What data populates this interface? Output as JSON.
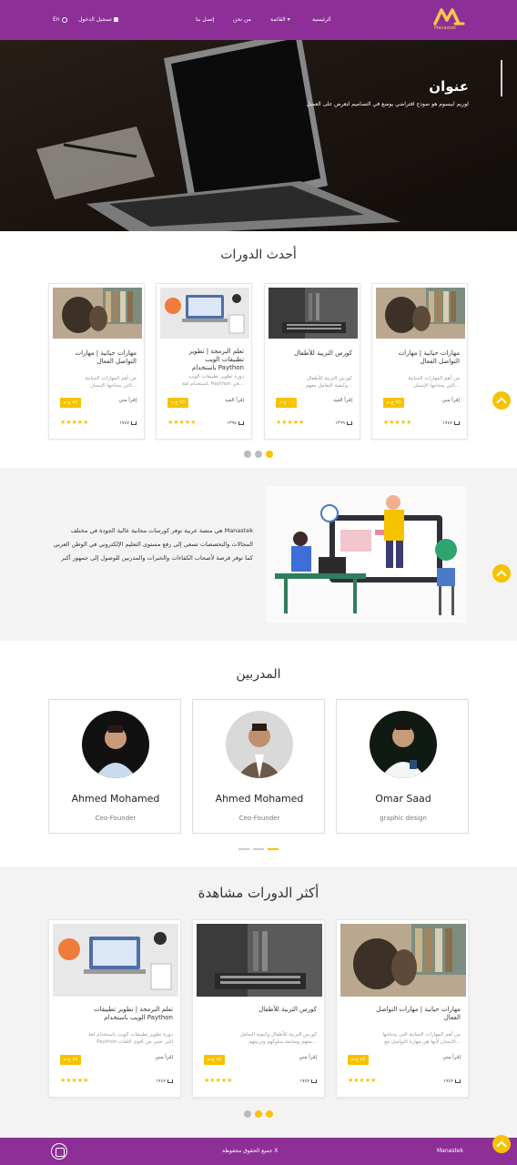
{
  "header": {
    "logo_text": "Manastek",
    "nav": {
      "home": "الرئيسية",
      "menu": "القائمة ▾",
      "about": "من نحن",
      "contact": "إتصل بنا",
      "login": "تسجيل الدخول",
      "lang": "En"
    }
  },
  "hero": {
    "title": "عنوان",
    "subtitle": "لوريم ايبسوم هو نموذج افتراضي يوضع في التصاميم لتعرض على العميل"
  },
  "latest": {
    "title": "أحدث الدورات",
    "cards": [
      {
        "title_1": "مهارات حياتية | مهارات",
        "title_2": "التواصل الفعال",
        "desc_1": "من أهم المهارات الحياتية",
        "desc_2": "التي يحتاجها الإنسان...",
        "teacher": "إقرأ مني",
        "price": "٤٥ ج.م",
        "views": "١٧٤٧",
        "stars": "★★★★★"
      },
      {
        "title_1": "كورس التربية للأطفال",
        "title_2": "",
        "desc_1": "كورس التربية للأطفال",
        "desc_2": "وكيفية التعامل معهم...",
        "teacher": "إقرأ العيد",
        "price": "٠٠ ج.م",
        "views": "١٣٦٩",
        "stars": "★★★★★"
      },
      {
        "title_1": "تعلم البرمجة | تطوير",
        "title_2": "تطبيقات الويب",
        "title_3": "باستخدام Paython",
        "desc_1": "دورة تطوير تطبيقات الويب",
        "desc_2": "باستخدام لغة Paython في...",
        "teacher": "إقرأ العيد",
        "price": "٤٥ ج.م",
        "views": "١٣٩٤",
        "stars": "★★★★★"
      },
      {
        "title_1": "مهارات حياتية | مهارات",
        "title_2": "التواصل الفعال",
        "desc_1": "من أهم المهارات الحياتية",
        "desc_2": "التي يحتاجها الإنسان...",
        "teacher": "إقرأ مني",
        "price": "٤٥ ج.م",
        "views": "١٧٤٧",
        "stars": "★★★★★"
      }
    ]
  },
  "about": {
    "text": "Manastek هي منصة عربية توفر كورسات مجانية عالية الجودة في مختلف المجالات والتخصصات تسعى إلى رفع مستوى التعليم الإلكتروني في الوطن العربي كما توفر فرصة لأصحاب الكفاءات والخبرات والمدربين للوصول إلى جمهور أكبر"
  },
  "trainers": {
    "title": "المدربين",
    "items": [
      {
        "name": "Ahmed Mohamed",
        "role": "Ceo-Founder"
      },
      {
        "name": "Ahmed Mohamed",
        "role": "Ceo-Founder"
      },
      {
        "name": "Omar Saad",
        "role": "graphic design"
      }
    ]
  },
  "most_viewed": {
    "title": "أكثر الدورات مشاهدة",
    "cards": [
      {
        "title_1": "تعلم البرمجة | تطوير تطبيقات",
        "title_2": "الويب باستخدام Paython",
        "desc_1": "دورة تطوير تطبيقات الويب باستخدام لغة",
        "desc_2": "Paython التي تعتبر من أقوى اللغات",
        "teacher": "إقرأ مني",
        "price": "٤٥ ج.م",
        "views": "١٧٤٧",
        "stars": "★★★★★"
      },
      {
        "title_1": "كورس التربية للأطفال",
        "title_2": "",
        "desc_1": "كورس التربية للأطفال وكيفية التعامل",
        "desc_2": "معهم ومتابعة سلوكهم وتربيتهم...",
        "teacher": "إقرأ مني",
        "price": "٤٥ ج.م",
        "views": "١٧٤٧",
        "stars": "★★★★★"
      },
      {
        "title_1": "مهارات حياتية | مهارات التواصل",
        "title_2": "الفعال",
        "desc_1": "من أهم المهارات الحياتية التي يحتاجها",
        "desc_2": "الإنسان لأنها هي مهارة التواصل مع...",
        "teacher": "إقرأ مني",
        "price": "٤٥ ج.م",
        "views": "١٧٤٧",
        "stars": "★★★★★"
      }
    ]
  },
  "footer": {
    "brand": "Manastek",
    "copyright": "جميع الحقوق محفوظة X"
  },
  "colors": {
    "brand_purple": "#8e2f98",
    "accent_yellow": "#f7c200"
  }
}
